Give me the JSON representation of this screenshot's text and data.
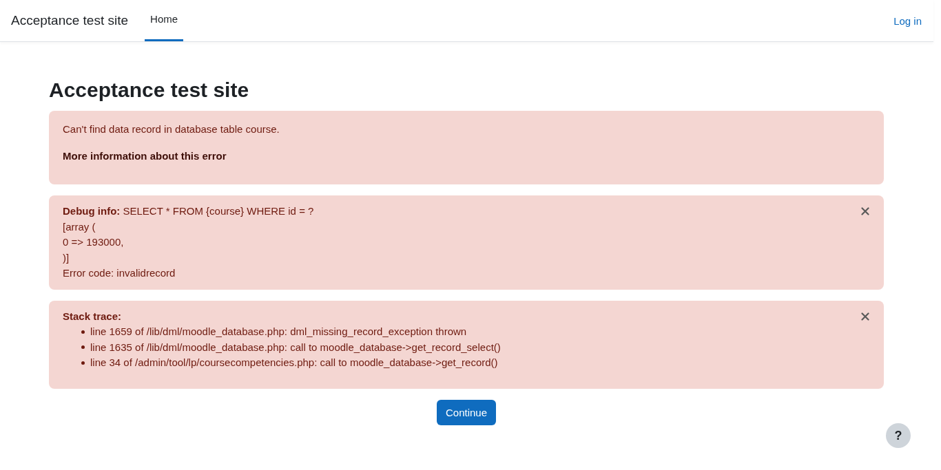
{
  "header": {
    "site_name": "Acceptance test site",
    "nav": [
      {
        "label": "Home",
        "selected": true
      }
    ],
    "login_link": "Log in"
  },
  "page_title": "Acceptance test site",
  "error_alert": {
    "message": "Can't find data record in database table course.",
    "more_info_link": "More information about this error"
  },
  "debug_alert": {
    "lines": [
      "**Debug info:** SELECT * FROM {course} WHERE id = ?",
      "[array (",
      "0 => 193000,",
      ")]",
      "Error code: invalidrecord"
    ]
  },
  "stack_alert": {
    "title": "Stack trace:",
    "items": [
      "line 1659 of /lib/dml/moodle_database.php: dml_missing_record_exception thrown",
      "line 1635 of /lib/dml/moodle_database.php: call to moodle_database->get_record_select()",
      "line 34 of /admin/tool/lp/coursecompetencies.php: call to moodle_database->get_record()"
    ]
  },
  "continue_button": "Continue",
  "help_button": "?"
}
